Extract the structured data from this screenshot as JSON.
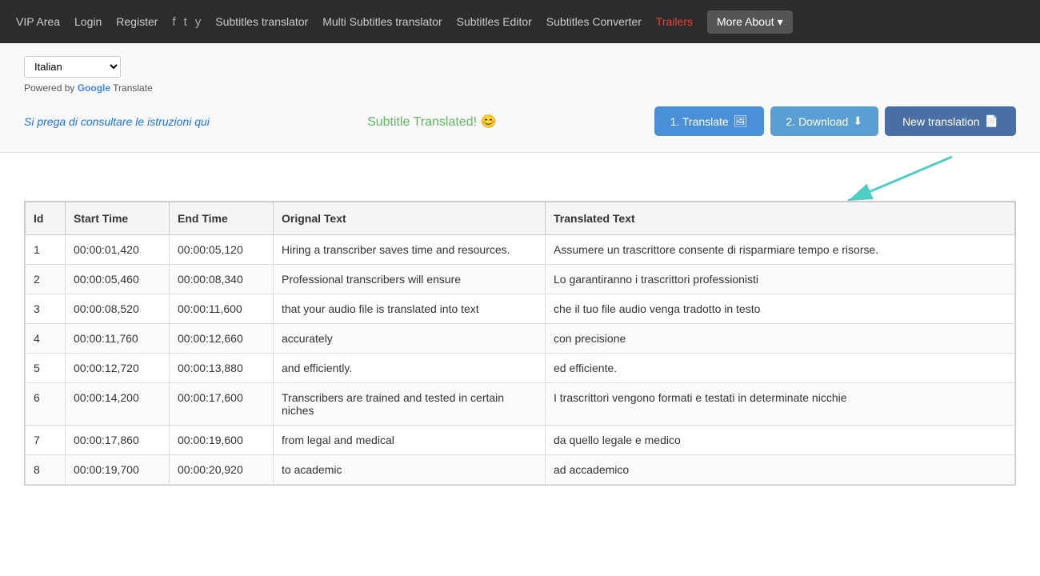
{
  "nav": {
    "vip_area": "VIP Area",
    "login": "Login",
    "register": "Register",
    "subtitles_translator": "Subtitles translator",
    "multi_subtitles_translator": "Multi Subtitles translator",
    "subtitles_editor": "Subtitles Editor",
    "subtitles_converter": "Subtitles Converter",
    "trailers": "Trailers",
    "more_about": "More About"
  },
  "top": {
    "lang_selected": "Italian",
    "powered_by_prefix": "Powered by ",
    "google": "Google",
    "translate": " Translate",
    "instruction_link": "Si prega di consultare le istruzioni qui",
    "subtitle_translated": "Subtitle Translated! 😊",
    "btn_translate": "1. Translate",
    "btn_download": "2. Download",
    "btn_new_translation": "New translation"
  },
  "table": {
    "columns": [
      "Id",
      "Start Time",
      "End Time",
      "Orignal Text",
      "Translated Text"
    ],
    "rows": [
      {
        "id": "1",
        "start": "00:00:01,420",
        "end": "00:00:05,120",
        "original": "Hiring a transcriber saves time and resources.",
        "translated": "Assumere un trascrittore consente di risparmiare tempo e risorse."
      },
      {
        "id": "2",
        "start": "00:00:05,460",
        "end": "00:00:08,340",
        "original": "Professional transcribers will ensure",
        "translated": "Lo garantiranno i trascrittori professionisti"
      },
      {
        "id": "3",
        "start": "00:00:08,520",
        "end": "00:00:11,600",
        "original": "that your audio file is translated into text",
        "translated": "che il tuo file audio venga tradotto in testo"
      },
      {
        "id": "4",
        "start": "00:00:11,760",
        "end": "00:00:12,660",
        "original": "accurately",
        "translated": "con precisione"
      },
      {
        "id": "5",
        "start": "00:00:12,720",
        "end": "00:00:13,880",
        "original": "and efficiently.",
        "translated": "ed efficiente."
      },
      {
        "id": "6",
        "start": "00:00:14,200",
        "end": "00:00:17,600",
        "original": "Transcribers are trained and tested in certain niches",
        "translated": "I trascrittori vengono formati e testati in determinate nicchie"
      },
      {
        "id": "7",
        "start": "00:00:17,860",
        "end": "00:00:19,600",
        "original": "from legal and medical",
        "translated": "da quello legale e medico"
      },
      {
        "id": "8",
        "start": "00:00:19,700",
        "end": "00:00:20,920",
        "original": "to academic",
        "translated": "ad accademico"
      }
    ]
  }
}
